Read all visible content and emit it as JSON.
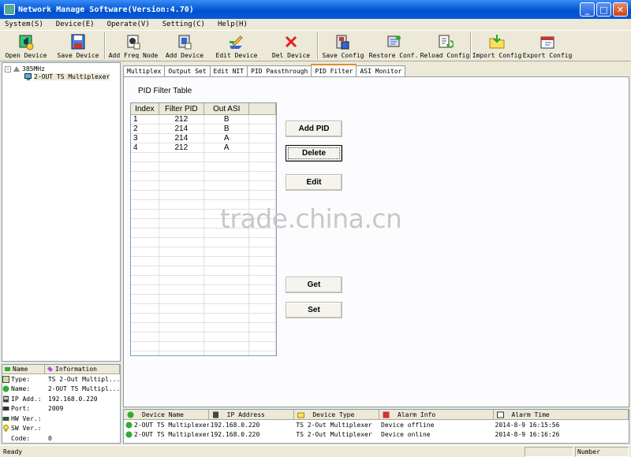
{
  "window": {
    "title": "Network Manage Software(Version:4.70)"
  },
  "menu": [
    "System(S)",
    "Device(E)",
    "Operate(V)",
    "Setting(C)",
    "Help(H)"
  ],
  "toolbar": [
    {
      "label": "Open Device",
      "icon": "open-device-icon"
    },
    {
      "label": "Save Device",
      "icon": "save-device-icon"
    },
    {
      "label": "Add Freq Node",
      "icon": "add-freq-node-icon"
    },
    {
      "label": "Add Device",
      "icon": "add-device-icon"
    },
    {
      "label": "Edit Device",
      "icon": "edit-device-icon"
    },
    {
      "label": "Del Device",
      "icon": "delete-icon"
    },
    {
      "label": "Save Config",
      "icon": "save-config-icon"
    },
    {
      "label": "Restore Conf.",
      "icon": "restore-config-icon"
    },
    {
      "label": "Reload Config",
      "icon": "reload-config-icon"
    },
    {
      "label": "Import Config",
      "icon": "import-config-icon"
    },
    {
      "label": "Export Config",
      "icon": "export-config-icon"
    }
  ],
  "tree": {
    "root": "385MHz",
    "child": "2-OUT TS Multiplexer",
    "expander": "-"
  },
  "info": {
    "headers": [
      "Name",
      "Information"
    ],
    "rows": [
      {
        "key": "Type:",
        "value": "TS 2-Out Multipl..."
      },
      {
        "key": "Name:",
        "value": "2-OUT TS Multipl..."
      },
      {
        "key": "IP Add.:",
        "value": "192.168.0.220"
      },
      {
        "key": "Port:",
        "value": "2009"
      },
      {
        "key": "HW Ver.:",
        "value": ""
      },
      {
        "key": "SW Ver.:",
        "value": ""
      },
      {
        "key": "Code:",
        "value": "0"
      }
    ]
  },
  "tabs": [
    "Multiplex",
    "Output Set",
    "Edit NIT",
    "PID Passthrough",
    "PID Filter",
    "ASI Monitor"
  ],
  "active_tab": 4,
  "pid_filter": {
    "title": "PID Filter Table",
    "columns": [
      "Index",
      "Filter PID",
      "Out ASI"
    ],
    "rows": [
      [
        "1",
        "212",
        "B"
      ],
      [
        "2",
        "214",
        "B"
      ],
      [
        "3",
        "214",
        "A"
      ],
      [
        "4",
        "212",
        "A"
      ]
    ],
    "buttons": {
      "add": "Add PID",
      "delete": "Delete",
      "edit": "Edit",
      "get": "Get",
      "set": "Set"
    }
  },
  "watermark": "trade.china.cn",
  "alarms": {
    "headers": [
      "Device Name",
      "IP Address",
      "Device Type",
      "Alarm Info",
      "Alarm Time"
    ],
    "rows": [
      [
        "2-OUT TS Multiplexer",
        "192.168.0.220",
        "TS 2-Out Multiplexer",
        "Device offline",
        "2014-8-9 16:15:56"
      ],
      [
        "2-OUT TS Multiplexer",
        "192.168.0.220",
        "TS 2-Out Multiplexer",
        "Device online",
        "2014-8-9 16:16:26"
      ]
    ]
  },
  "status": {
    "text": "Ready",
    "pane": "Number"
  }
}
